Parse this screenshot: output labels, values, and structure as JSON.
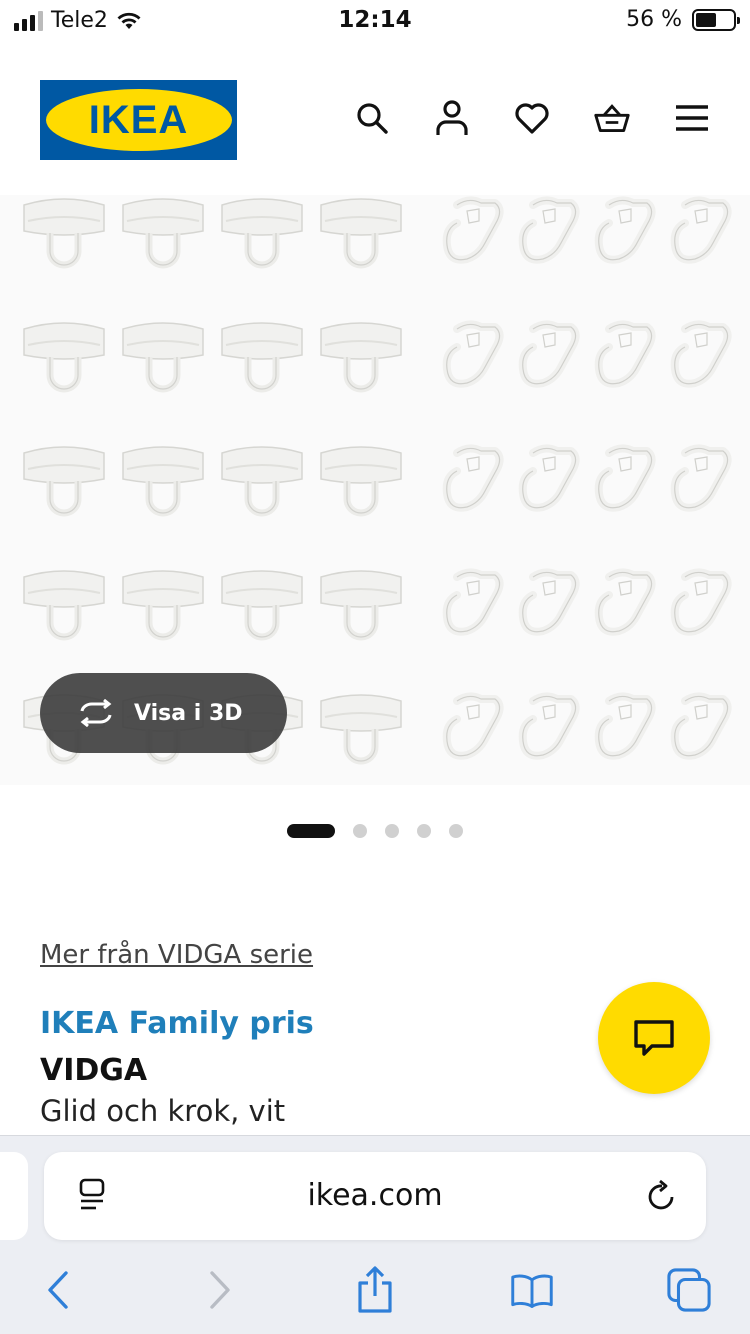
{
  "status_bar": {
    "carrier": "Tele2",
    "time": "12:14",
    "battery": "56 %",
    "battery_level": 0.56
  },
  "header": {
    "logo_text": "IKEA",
    "icons": [
      "search-icon",
      "profile-icon",
      "heart-icon",
      "cart-icon",
      "menu-icon"
    ]
  },
  "gallery": {
    "view_3d_label": "Visa i 3D",
    "slide_count": 5,
    "active_slide": 1
  },
  "product": {
    "series_link": "Mer från VIDGA serie",
    "family_price_label": "IKEA Family pris",
    "name": "VIDGA",
    "description": "Glid och krok, vit"
  },
  "safari": {
    "url": "ikea.com",
    "toolbar_icons": [
      "back-icon",
      "forward-icon",
      "share-icon",
      "bookmarks-icon",
      "tabs-icon"
    ]
  },
  "colors": {
    "ikea_blue": "#0058a3",
    "ikea_yellow": "#ffdb00",
    "family_blue": "#1f7fba",
    "safari_blue": "#2f7fd8"
  }
}
